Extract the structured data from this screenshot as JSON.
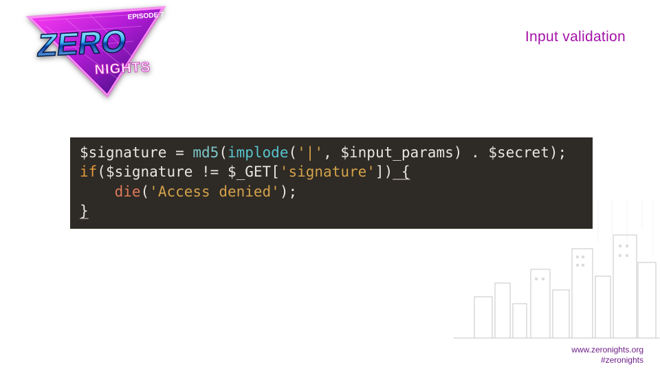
{
  "logo": {
    "main_text": "ZERO",
    "sub_text": "NIGHTS",
    "tag": "EPISODE 7"
  },
  "title": "Input validation",
  "code": {
    "line1": {
      "var_sig": "$signature",
      "eq": " = ",
      "md5": "md5",
      "p1": "(",
      "implode": "implode",
      "p2": "(",
      "str_pipe": "'|'",
      "comma": ", ",
      "var_input": "$input_params",
      "p3": ")",
      "dot": " . ",
      "var_secret": "$secret",
      "p4": ")",
      "semi": ";"
    },
    "line2": {
      "if": "if",
      "p1": "(",
      "var_sig": "$signature",
      "neq": " != ",
      "var_get": "$_GET",
      "br1": "[",
      "str_sig": "'signature'",
      "br2": "]",
      "p2": ")",
      "brace": " {"
    },
    "line3": {
      "indent": "    ",
      "die": "die",
      "p1": "(",
      "str": "'Access denied'",
      "p2": ")",
      "semi": ";"
    },
    "line4": {
      "brace": "}"
    }
  },
  "footer": {
    "url": "www.zeronights.org",
    "hashtag": "#zeronights"
  }
}
